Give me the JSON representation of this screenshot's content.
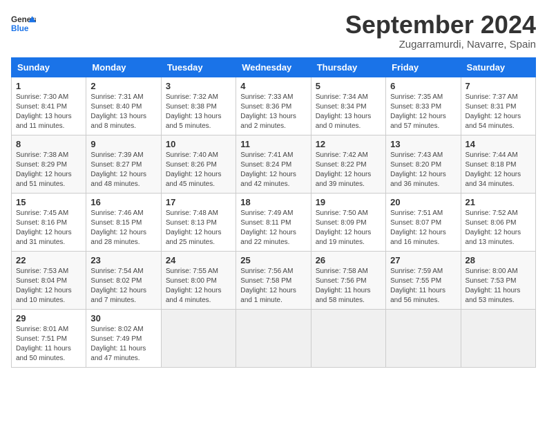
{
  "logo": {
    "line1": "General",
    "line2": "Blue"
  },
  "title": "September 2024",
  "location": "Zugarramurdi, Navarre, Spain",
  "weekdays": [
    "Sunday",
    "Monday",
    "Tuesday",
    "Wednesday",
    "Thursday",
    "Friday",
    "Saturday"
  ],
  "weeks": [
    [
      {
        "day": "1",
        "sunrise": "7:30 AM",
        "sunset": "8:41 PM",
        "daylight": "13 hours and 11 minutes."
      },
      {
        "day": "2",
        "sunrise": "7:31 AM",
        "sunset": "8:40 PM",
        "daylight": "13 hours and 8 minutes."
      },
      {
        "day": "3",
        "sunrise": "7:32 AM",
        "sunset": "8:38 PM",
        "daylight": "13 hours and 5 minutes."
      },
      {
        "day": "4",
        "sunrise": "7:33 AM",
        "sunset": "8:36 PM",
        "daylight": "13 hours and 2 minutes."
      },
      {
        "day": "5",
        "sunrise": "7:34 AM",
        "sunset": "8:34 PM",
        "daylight": "13 hours and 0 minutes."
      },
      {
        "day": "6",
        "sunrise": "7:35 AM",
        "sunset": "8:33 PM",
        "daylight": "12 hours and 57 minutes."
      },
      {
        "day": "7",
        "sunrise": "7:37 AM",
        "sunset": "8:31 PM",
        "daylight": "12 hours and 54 minutes."
      }
    ],
    [
      {
        "day": "8",
        "sunrise": "7:38 AM",
        "sunset": "8:29 PM",
        "daylight": "12 hours and 51 minutes."
      },
      {
        "day": "9",
        "sunrise": "7:39 AM",
        "sunset": "8:27 PM",
        "daylight": "12 hours and 48 minutes."
      },
      {
        "day": "10",
        "sunrise": "7:40 AM",
        "sunset": "8:26 PM",
        "daylight": "12 hours and 45 minutes."
      },
      {
        "day": "11",
        "sunrise": "7:41 AM",
        "sunset": "8:24 PM",
        "daylight": "12 hours and 42 minutes."
      },
      {
        "day": "12",
        "sunrise": "7:42 AM",
        "sunset": "8:22 PM",
        "daylight": "12 hours and 39 minutes."
      },
      {
        "day": "13",
        "sunrise": "7:43 AM",
        "sunset": "8:20 PM",
        "daylight": "12 hours and 36 minutes."
      },
      {
        "day": "14",
        "sunrise": "7:44 AM",
        "sunset": "8:18 PM",
        "daylight": "12 hours and 34 minutes."
      }
    ],
    [
      {
        "day": "15",
        "sunrise": "7:45 AM",
        "sunset": "8:16 PM",
        "daylight": "12 hours and 31 minutes."
      },
      {
        "day": "16",
        "sunrise": "7:46 AM",
        "sunset": "8:15 PM",
        "daylight": "12 hours and 28 minutes."
      },
      {
        "day": "17",
        "sunrise": "7:48 AM",
        "sunset": "8:13 PM",
        "daylight": "12 hours and 25 minutes."
      },
      {
        "day": "18",
        "sunrise": "7:49 AM",
        "sunset": "8:11 PM",
        "daylight": "12 hours and 22 minutes."
      },
      {
        "day": "19",
        "sunrise": "7:50 AM",
        "sunset": "8:09 PM",
        "daylight": "12 hours and 19 minutes."
      },
      {
        "day": "20",
        "sunrise": "7:51 AM",
        "sunset": "8:07 PM",
        "daylight": "12 hours and 16 minutes."
      },
      {
        "day": "21",
        "sunrise": "7:52 AM",
        "sunset": "8:06 PM",
        "daylight": "12 hours and 13 minutes."
      }
    ],
    [
      {
        "day": "22",
        "sunrise": "7:53 AM",
        "sunset": "8:04 PM",
        "daylight": "12 hours and 10 minutes."
      },
      {
        "day": "23",
        "sunrise": "7:54 AM",
        "sunset": "8:02 PM",
        "daylight": "12 hours and 7 minutes."
      },
      {
        "day": "24",
        "sunrise": "7:55 AM",
        "sunset": "8:00 PM",
        "daylight": "12 hours and 4 minutes."
      },
      {
        "day": "25",
        "sunrise": "7:56 AM",
        "sunset": "7:58 PM",
        "daylight": "12 hours and 1 minute."
      },
      {
        "day": "26",
        "sunrise": "7:58 AM",
        "sunset": "7:56 PM",
        "daylight": "11 hours and 58 minutes."
      },
      {
        "day": "27",
        "sunrise": "7:59 AM",
        "sunset": "7:55 PM",
        "daylight": "11 hours and 56 minutes."
      },
      {
        "day": "28",
        "sunrise": "8:00 AM",
        "sunset": "7:53 PM",
        "daylight": "11 hours and 53 minutes."
      }
    ],
    [
      {
        "day": "29",
        "sunrise": "8:01 AM",
        "sunset": "7:51 PM",
        "daylight": "11 hours and 50 minutes."
      },
      {
        "day": "30",
        "sunrise": "8:02 AM",
        "sunset": "7:49 PM",
        "daylight": "11 hours and 47 minutes."
      },
      null,
      null,
      null,
      null,
      null
    ]
  ]
}
